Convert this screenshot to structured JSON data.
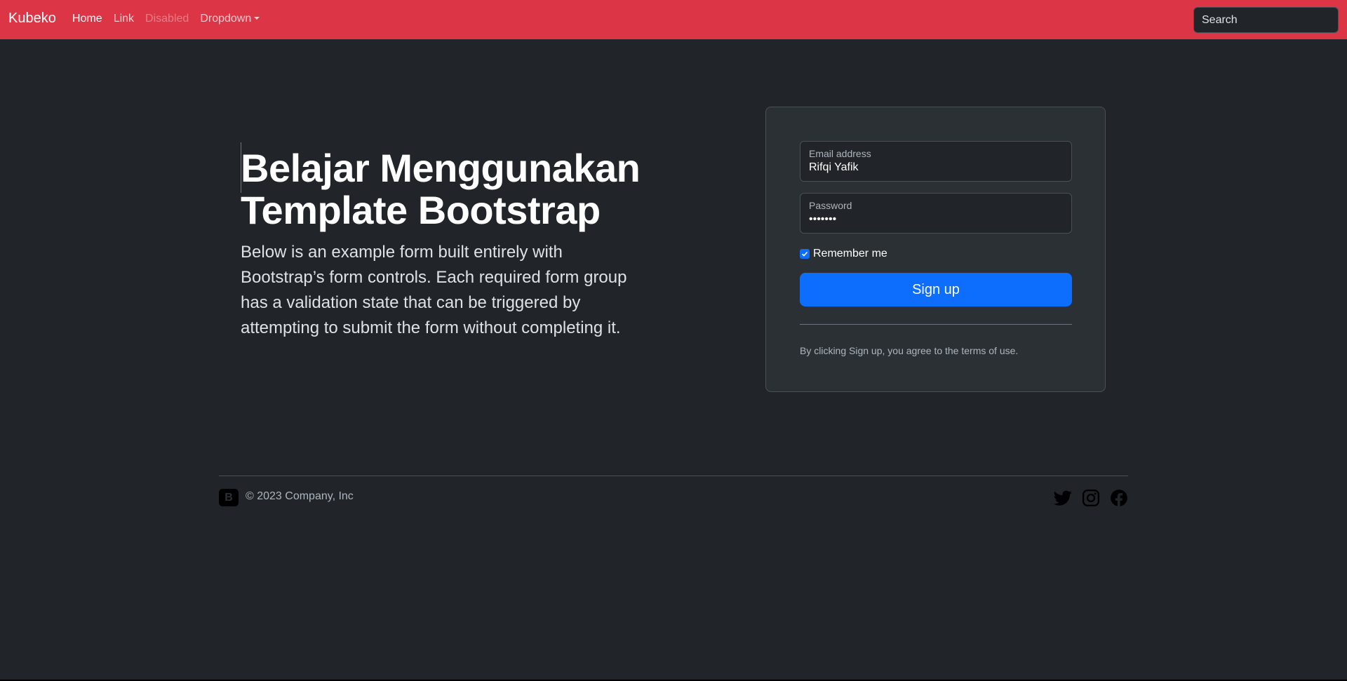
{
  "navbar": {
    "brand": "Kubeko",
    "links": [
      {
        "label": "Home",
        "state": "active"
      },
      {
        "label": "Link",
        "state": "normal"
      },
      {
        "label": "Disabled",
        "state": "disabled"
      },
      {
        "label": "Dropdown",
        "state": "dropdown"
      }
    ],
    "search_placeholder": "Search"
  },
  "hero": {
    "title_line1": "Belajar Menggunakan",
    "title_line2": "Template Bootstrap",
    "lead": "Below is an example form built entirely with Bootstrap’s form controls. Each required form group has a validation state that can be triggered by attempting to submit the form without completing it."
  },
  "form": {
    "email_label": "Email address",
    "email_value": "Rifqi Yafik",
    "password_label": "Password",
    "password_value": "•••••••",
    "remember_label": "Remember me",
    "remember_checked": true,
    "submit_label": "Sign up",
    "terms": "By clicking Sign up, you agree to the terms of use."
  },
  "footer": {
    "logo_letter": "B",
    "copyright": "© 2023 Company, Inc",
    "social": [
      "twitter-icon",
      "instagram-icon",
      "facebook-icon"
    ]
  },
  "colors": {
    "navbar": "#dc3545",
    "background": "#212529",
    "card": "#2b3035",
    "primary": "#0d6efd"
  }
}
